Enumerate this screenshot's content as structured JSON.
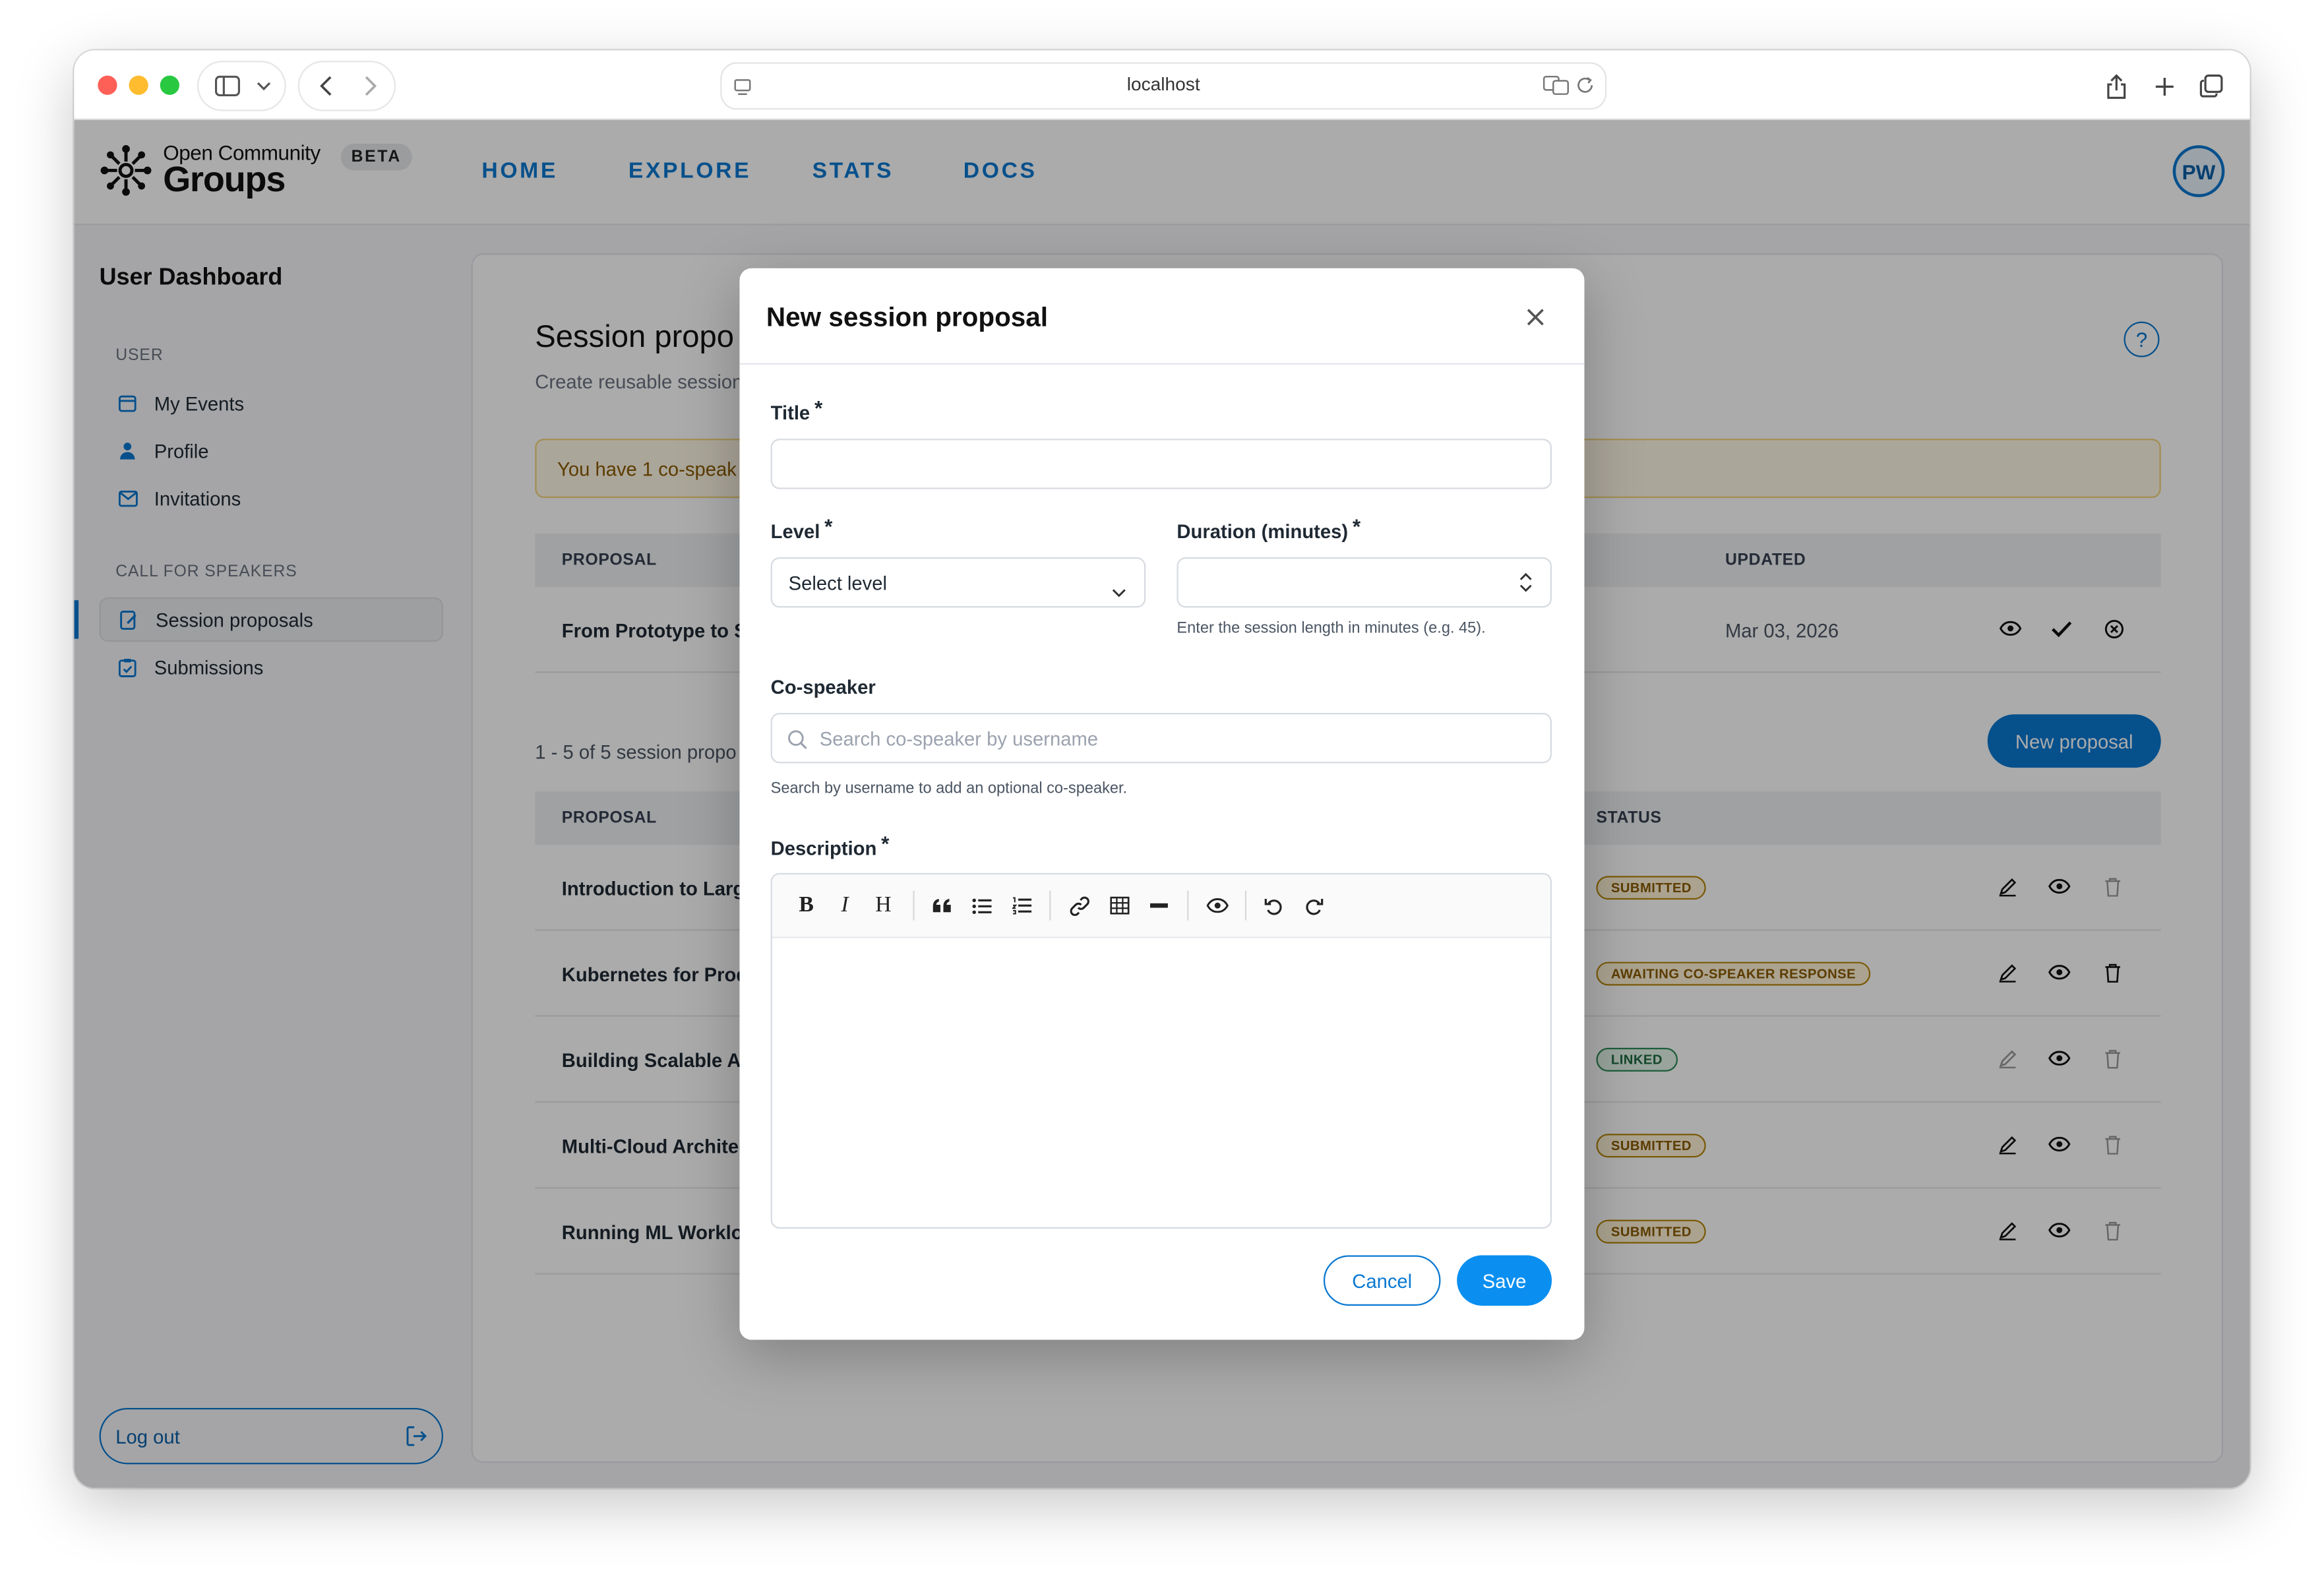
{
  "browser": {
    "url": "localhost"
  },
  "brand": {
    "line1": "Open Community",
    "line2": "Groups",
    "badge": "BETA"
  },
  "nav": {
    "items": [
      "HOME",
      "EXPLORE",
      "STATS",
      "DOCS"
    ],
    "avatar_initials": "PW"
  },
  "sidebar": {
    "title": "User Dashboard",
    "user_group": "USER",
    "user_items": [
      "My Events",
      "Profile",
      "Invitations"
    ],
    "cfs_group": "CALL FOR SPEAKERS",
    "cfs_items": [
      "Session proposals",
      "Submissions"
    ],
    "logout": "Log out"
  },
  "content": {
    "title": "Session propo",
    "subtitle": "Create reusable session",
    "alert": "You have 1 co-speak",
    "table1_headers": {
      "proposal": "PROPOSAL",
      "updated": "UPDATED"
    },
    "table1_row": {
      "title": "From Prototype to S",
      "updated": "Mar 03, 2026"
    },
    "count": "1 - 5 of 5 session propo",
    "new_proposal": "New proposal",
    "table2_headers": {
      "proposal": "PROPOSAL",
      "status": "STATUS"
    },
    "rows": [
      {
        "title": "Introduction to Large",
        "status": "SUBMITTED"
      },
      {
        "title": "Kubernetes for Prod",
        "status": "AWAITING CO-SPEAKER RESPONSE"
      },
      {
        "title": "Building Scalable AI",
        "status": "LINKED"
      },
      {
        "title": "Multi-Cloud Architec",
        "status": "SUBMITTED"
      },
      {
        "title": "Running ML Workloa",
        "status": "SUBMITTED"
      }
    ]
  },
  "modal": {
    "title": "New session proposal",
    "title_label": "Title",
    "required_mark": "*",
    "level_label": "Level",
    "level_value": "Select level",
    "duration_label": "Duration (minutes)",
    "duration_help": "Enter the session length in minutes (e.g. 45).",
    "cospeaker_label": "Co-speaker",
    "cospeaker_placeholder": "Search co-speaker by username",
    "cospeaker_help": "Search by username to add an optional co-speaker.",
    "description_label": "Description",
    "toolbar": {
      "bold": "B",
      "italic": "I",
      "heading": "H"
    },
    "cancel": "Cancel",
    "save": "Save"
  },
  "colors": {
    "accent": "#0a78d1",
    "save": "#0a8ff0",
    "submitted_badge": "#fff3d6",
    "linked_badge": "#e3f5e9"
  }
}
